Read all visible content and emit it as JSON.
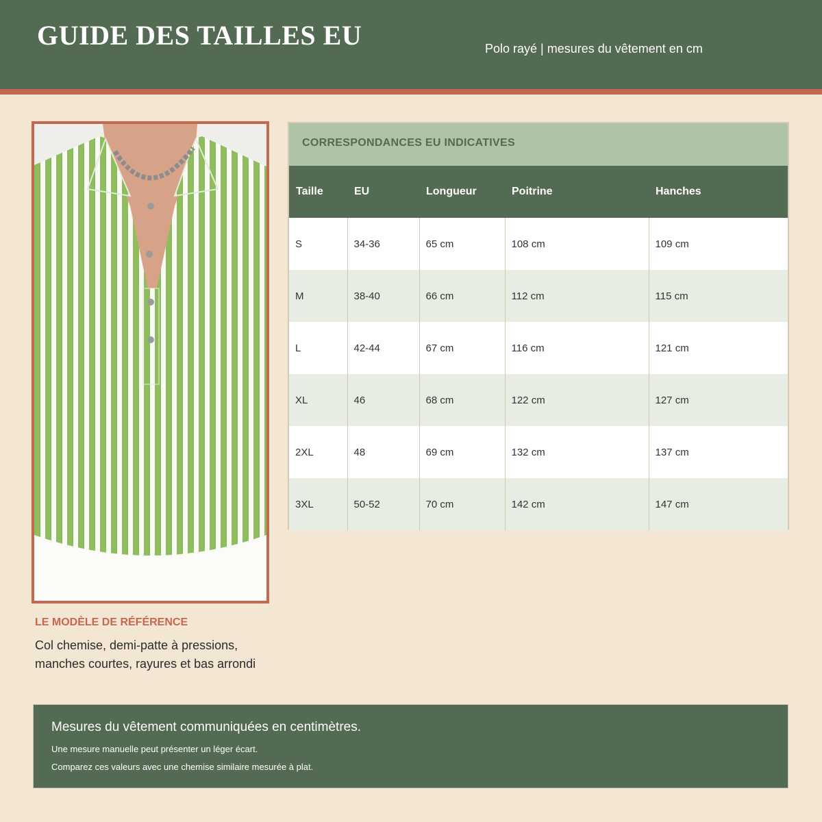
{
  "header": {
    "title": "GUIDE DES TAILLES EU",
    "subtitle": "Polo rayé | mesures du vêtement en cm"
  },
  "reference": {
    "title": "LE MODÈLE DE RÉFÉRENCE",
    "description": "Col chemise, demi-patte à pressions, manches courtes, rayures et bas arrondi"
  },
  "size_table": {
    "caption": "CORRESPONDANCES EU INDICATIVES",
    "columns": [
      "Taille",
      "EU",
      "Longueur",
      "Poitrine",
      "Hanches"
    ],
    "rows": [
      [
        "S",
        "34-36",
        "65 cm",
        "108 cm",
        "109 cm"
      ],
      [
        "M",
        "38-40",
        "66 cm",
        "112 cm",
        "115 cm"
      ],
      [
        "L",
        "42-44",
        "67 cm",
        "116 cm",
        "121 cm"
      ],
      [
        "XL",
        "46",
        "68 cm",
        "122 cm",
        "127 cm"
      ],
      [
        "2XL",
        "48",
        "69 cm",
        "132 cm",
        "137 cm"
      ],
      [
        "3XL",
        "50-52",
        "70 cm",
        "142 cm",
        "147 cm"
      ]
    ]
  },
  "footer": {
    "main_note": "Mesures du vêtement communiquées en centimètres.",
    "note_1": "Une mesure manuelle peut présenter un léger écart.",
    "note_2": "Comparez ces valeurs avec une chemise similaire mesurée à plat."
  },
  "colors": {
    "header_green": "#536a53",
    "accent_terracotta": "#c6684f",
    "caption_sage": "#aec4a6",
    "background_cream": "#f3e7d4",
    "stripe_green": "#8fbc5c"
  }
}
